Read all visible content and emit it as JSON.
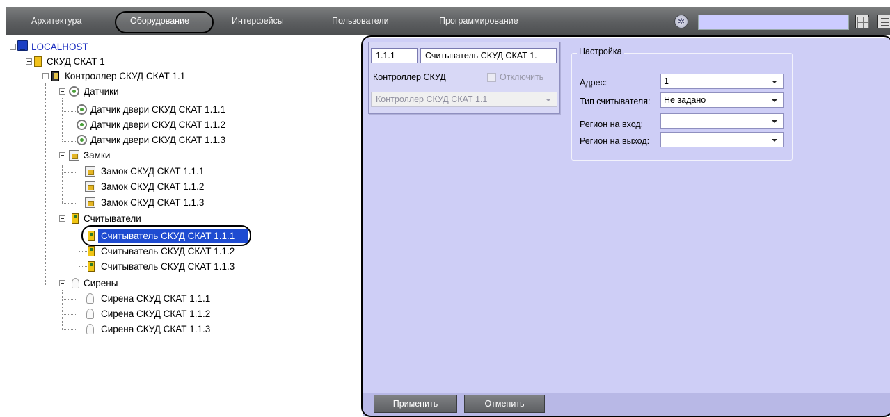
{
  "menu": {
    "tabs": [
      {
        "label": "Архитектура"
      },
      {
        "label": "Оборудование"
      },
      {
        "label": "Интерфейсы"
      },
      {
        "label": "Пользователи"
      },
      {
        "label": "Программирование"
      }
    ],
    "search_value": ""
  },
  "tree": {
    "root": "LOCALHOST",
    "skud": "СКУД СКАТ 1",
    "controller": "Контроллер СКУД СКАТ 1.1",
    "sensors_group": "Датчики",
    "sensors": [
      "Датчик двери СКУД СКАТ 1.1.1",
      "Датчик двери СКУД СКАТ 1.1.2",
      "Датчик двери СКУД СКАТ 1.1.3"
    ],
    "locks_group": "Замки",
    "locks": [
      "Замок СКУД СКАТ 1.1.1",
      "Замок СКУД СКАТ 1.1.2",
      "Замок СКУД СКАТ 1.1.3"
    ],
    "readers_group": "Считыватели",
    "readers": [
      "Считыватель СКУД СКАТ 1.1.1",
      "Считыватель СКУД СКАТ 1.1.2",
      "Считыватель СКУД СКАТ 1.1.3"
    ],
    "sirens_group": "Сирены",
    "sirens": [
      "Сирена СКУД СКАТ 1.1.1",
      "Сирена СКУД СКАТ 1.1.2",
      "Сирена СКУД СКАТ 1.1.3"
    ]
  },
  "object": {
    "id": "1.1.1",
    "name": "Считыватель СКУД СКАТ 1.",
    "parent_label": "Контроллер СКУД",
    "disable_label": "Отключить",
    "parent_value": "Контроллер СКУД СКАТ 1.1"
  },
  "settings": {
    "group_title": "Настройка",
    "address_label": "Адрес:",
    "address_value": "1",
    "reader_type_label": "Тип считывателя:",
    "reader_type_value": "Не задано",
    "region_in_label": "Регион на вход:",
    "region_in_value": "",
    "region_out_label": "Регион на выход:",
    "region_out_value": ""
  },
  "buttons": {
    "apply": "Применить",
    "cancel": "Отменить"
  }
}
